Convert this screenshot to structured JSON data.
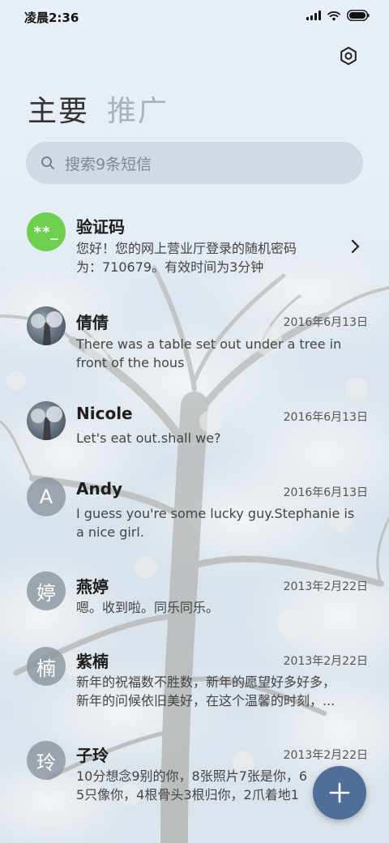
{
  "status_bar": {
    "time": "凌晨2:36"
  },
  "header": {
    "tabs": [
      {
        "label": "主要",
        "active": true
      },
      {
        "label": "推广",
        "active": false
      }
    ]
  },
  "search": {
    "placeholder": "搜索9条短信"
  },
  "conversations": [
    {
      "name": "验证码",
      "avatar_text": "**_",
      "avatar_kind": "otp",
      "date": "",
      "preview_lines": [
        "您好！您的网上营业厅登录的随机密码",
        "为：710679。有效时间为3分钟"
      ]
    },
    {
      "name": "倩倩",
      "avatar_kind": "photo",
      "date": "2016年6月13日",
      "preview_lines": [
        "There was a table set out under a tree in",
        "front of the hous"
      ]
    },
    {
      "name": "Nicole",
      "avatar_kind": "photo",
      "date": "2016年6月13日",
      "preview_lines": [
        "Let's eat out.shall we?"
      ]
    },
    {
      "name": "Andy",
      "avatar_text": "A",
      "avatar_kind": "letter",
      "date": "2016年6月13日",
      "preview_lines": [
        "I guess you're some lucky guy.Stephanie is",
        "a nice girl."
      ]
    },
    {
      "name": "燕婷",
      "avatar_text": "婷",
      "avatar_kind": "letter",
      "date": "2013年2月22日",
      "preview_lines": [
        "嗯。收到啦。同乐同乐。"
      ]
    },
    {
      "name": "紫楠",
      "avatar_text": "楠",
      "avatar_kind": "letter",
      "date": "2013年2月22日",
      "preview_lines": [
        "新年的祝福数不胜数，新年的愿望好多好多，",
        "新年的问候依旧美好，在这个温馨的时刻，..."
      ]
    },
    {
      "name": "子玲",
      "avatar_text": "玲",
      "avatar_kind": "letter",
      "date": "2013年2月22日",
      "preview_lines": [
        "10分想念9别的你，8张照片7张是你，6",
        "5只像你，4根骨头3根归你，2爪着地1"
      ]
    }
  ],
  "colors": {
    "fab": "#4f6f99",
    "otp_avatar": "#6dcf4e",
    "letter_avatar": "#8c96a0"
  },
  "icons": {
    "settings": "gear-icon",
    "search": "search-icon",
    "open": "chevron-right-icon",
    "compose": "plus-icon"
  }
}
